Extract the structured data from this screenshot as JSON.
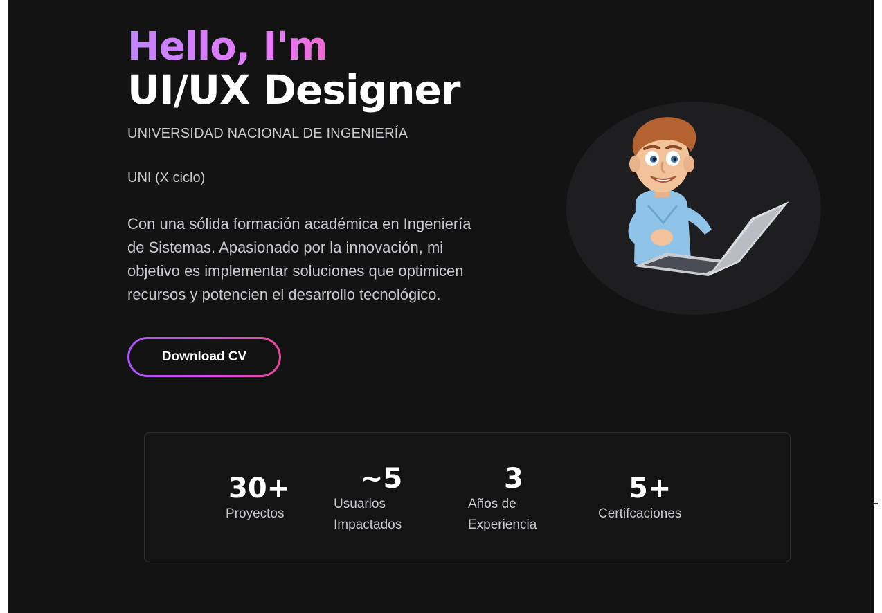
{
  "hero": {
    "greeting": "Hello, I'm",
    "role": "UI/UX Designer",
    "university": "UNIVERSIDAD NACIONAL DE INGENIERÍA",
    "university_short": "UNI (X ciclo)",
    "bio_lines": [
      "Con una sólida formación académica en Ingeniería",
      "de Sistemas. Apasionado por la innovación, mi",
      "objetivo es implementar soluciones que optimicen",
      "recursos y potencien el desarrollo tecnológico."
    ],
    "cta_label": "Download CV",
    "accent_gradient": [
      "#c084fc",
      "#e879f9",
      "#f43f5e"
    ]
  },
  "avatar": {
    "icon": "cartoon-developer-with-laptop"
  },
  "stats": [
    {
      "value": "30+",
      "label": "Proyectos"
    },
    {
      "value": "~5",
      "label_lines": [
        "Usuarios",
        "Impactados"
      ]
    },
    {
      "value": "3",
      "label_lines": [
        "Años de",
        "Experiencia"
      ]
    },
    {
      "value": "5+",
      "label": "Certifcaciones"
    }
  ],
  "colors": {
    "background": "#131314",
    "text_muted": "#c9c9cf",
    "card_border": "#2f2f33"
  }
}
